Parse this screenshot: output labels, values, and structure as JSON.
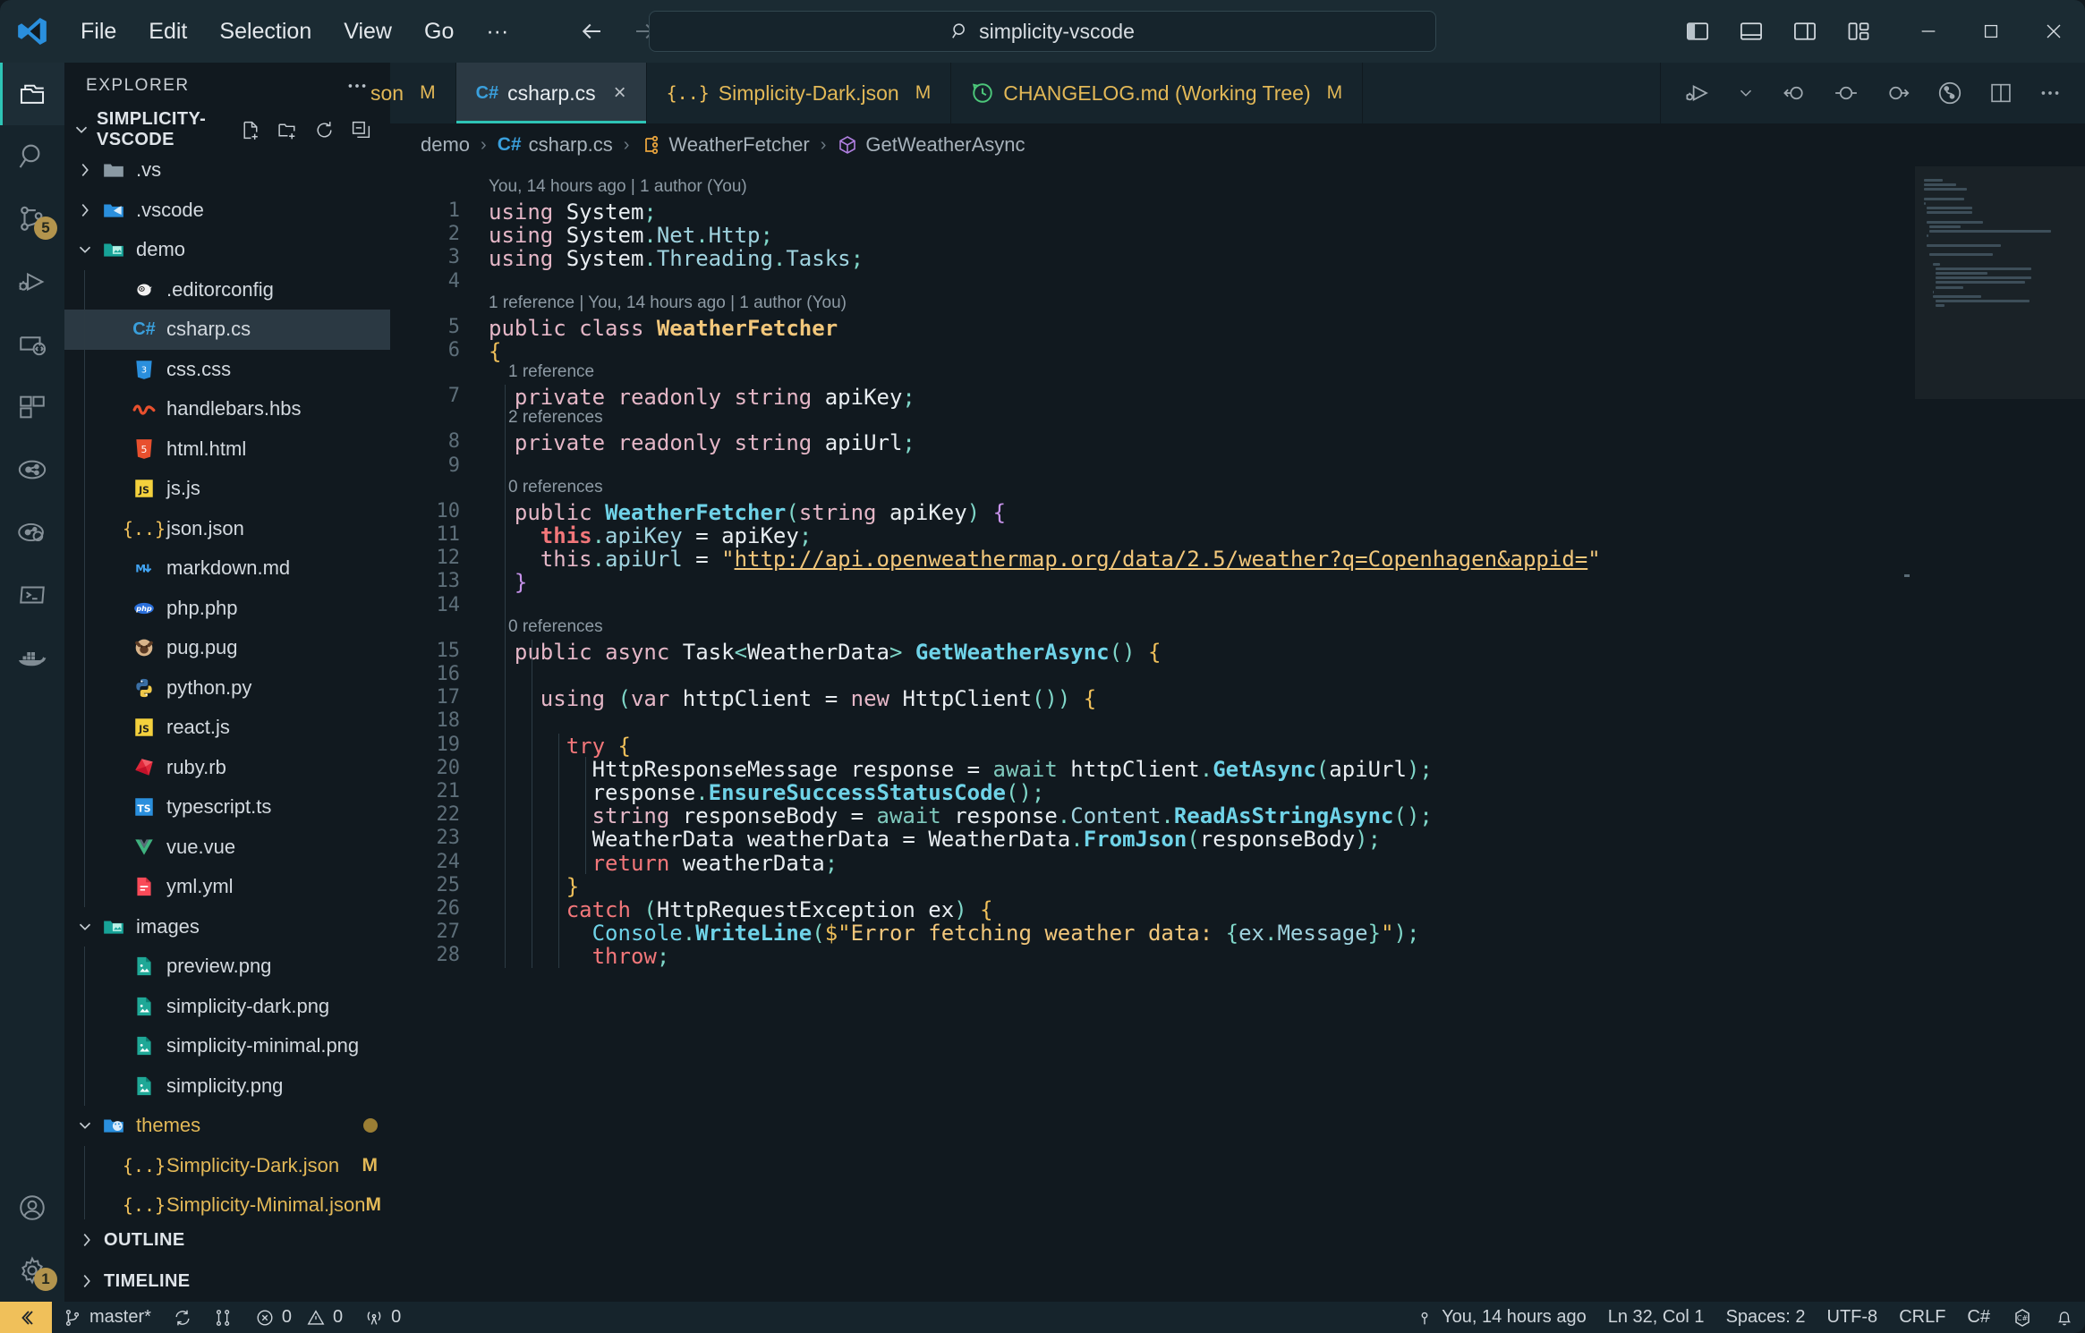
{
  "titlebar": {
    "menu": [
      "File",
      "Edit",
      "Selection",
      "View",
      "Go",
      "···"
    ],
    "command_center_text": "simplicity-vscode",
    "back_icon": "arrow-left-icon",
    "forward_icon": "arrow-right-icon",
    "search_icon": "search-icon",
    "layout_icons": [
      "toggle-primary-sidebar-icon",
      "toggle-panel-icon",
      "toggle-secondary-sidebar-icon",
      "customize-layout-icon"
    ],
    "window_controls": [
      "minimize",
      "maximize",
      "close"
    ]
  },
  "activitybar": {
    "items": [
      {
        "name": "explorer",
        "icon": "files-icon",
        "active": true,
        "badge": ""
      },
      {
        "name": "search",
        "icon": "search-icon",
        "active": false,
        "badge": ""
      },
      {
        "name": "source-control",
        "icon": "source-control-icon",
        "active": false,
        "badge": "5"
      },
      {
        "name": "run-and-debug",
        "icon": "debug-icon",
        "active": false,
        "badge": ""
      },
      {
        "name": "remote-explorer",
        "icon": "remote-explorer-icon",
        "active": false,
        "badge": ""
      },
      {
        "name": "extensions",
        "icon": "extensions-icon",
        "active": false,
        "badge": ""
      },
      {
        "name": "test-explorer",
        "icon": "beaker-icon",
        "active": false,
        "badge": ""
      },
      {
        "name": "live-share",
        "icon": "live-share-icon",
        "active": false,
        "badge": ""
      },
      {
        "name": "terminal",
        "icon": "terminal-icon",
        "active": false,
        "badge": ""
      },
      {
        "name": "docker",
        "icon": "docker-icon",
        "active": false,
        "badge": ""
      }
    ],
    "bottom_items": [
      {
        "name": "accounts",
        "icon": "account-icon",
        "badge": ""
      },
      {
        "name": "manage-settings",
        "icon": "gear-icon",
        "badge": "1"
      }
    ]
  },
  "sidebar": {
    "title": "EXPLORER",
    "more_actions_icon": "ellipsis-icon",
    "folder_section": {
      "label": "SIMPLICITY-VSCODE",
      "expanded": true,
      "actions": [
        "new-file-icon",
        "new-folder-icon",
        "refresh-icon",
        "collapse-all-icon"
      ]
    },
    "tree": [
      {
        "label": ".vs",
        "type": "folder",
        "depth": 0,
        "expanded": false,
        "icon": "folder-grey-icon",
        "git": ""
      },
      {
        "label": ".vscode",
        "type": "folder",
        "depth": 0,
        "expanded": false,
        "icon": "folder-vscode-icon",
        "git": ""
      },
      {
        "label": "demo",
        "type": "folder",
        "depth": 0,
        "expanded": true,
        "icon": "folder-demo-icon",
        "git": ""
      },
      {
        "label": ".editorconfig",
        "type": "file",
        "depth": 1,
        "icon": "editorconfig-icon",
        "git": ""
      },
      {
        "label": "csharp.cs",
        "type": "file",
        "depth": 1,
        "icon": "csharp-icon",
        "git": "",
        "selected": true
      },
      {
        "label": "css.css",
        "type": "file",
        "depth": 1,
        "icon": "css-icon",
        "git": ""
      },
      {
        "label": "handlebars.hbs",
        "type": "file",
        "depth": 1,
        "icon": "handlebars-icon",
        "git": ""
      },
      {
        "label": "html.html",
        "type": "file",
        "depth": 1,
        "icon": "html-icon",
        "git": ""
      },
      {
        "label": "js.js",
        "type": "file",
        "depth": 1,
        "icon": "javascript-icon",
        "git": ""
      },
      {
        "label": "json.json",
        "type": "file",
        "depth": 1,
        "icon": "json-icon",
        "git": ""
      },
      {
        "label": "markdown.md",
        "type": "file",
        "depth": 1,
        "icon": "markdown-icon",
        "git": ""
      },
      {
        "label": "php.php",
        "type": "file",
        "depth": 1,
        "icon": "php-icon",
        "git": ""
      },
      {
        "label": "pug.pug",
        "type": "file",
        "depth": 1,
        "icon": "pug-icon",
        "git": ""
      },
      {
        "label": "python.py",
        "type": "file",
        "depth": 1,
        "icon": "python-icon",
        "git": ""
      },
      {
        "label": "react.js",
        "type": "file",
        "depth": 1,
        "icon": "javascript-icon",
        "git": ""
      },
      {
        "label": "ruby.rb",
        "type": "file",
        "depth": 1,
        "icon": "ruby-icon",
        "git": ""
      },
      {
        "label": "typescript.ts",
        "type": "file",
        "depth": 1,
        "icon": "typescript-icon",
        "git": ""
      },
      {
        "label": "vue.vue",
        "type": "file",
        "depth": 1,
        "icon": "vue-icon",
        "git": ""
      },
      {
        "label": "yml.yml",
        "type": "file",
        "depth": 1,
        "icon": "yaml-icon",
        "git": ""
      },
      {
        "label": "images",
        "type": "folder",
        "depth": 0,
        "expanded": true,
        "icon": "folder-images-icon",
        "git": ""
      },
      {
        "label": "preview.png",
        "type": "file",
        "depth": 1,
        "icon": "image-icon",
        "git": ""
      },
      {
        "label": "simplicity-dark.png",
        "type": "file",
        "depth": 1,
        "icon": "image-icon",
        "git": ""
      },
      {
        "label": "simplicity-minimal.png",
        "type": "file",
        "depth": 1,
        "icon": "image-icon",
        "git": ""
      },
      {
        "label": "simplicity.png",
        "type": "file",
        "depth": 1,
        "icon": "image-icon",
        "git": ""
      },
      {
        "label": "themes",
        "type": "folder",
        "depth": 0,
        "expanded": true,
        "icon": "folder-themes-icon",
        "git": "dot",
        "modified": true
      },
      {
        "label": "Simplicity-Dark.json",
        "type": "file",
        "depth": 1,
        "icon": "json-icon",
        "git": "M",
        "modified": true
      },
      {
        "label": "Simplicity-Minimal.json",
        "type": "file",
        "depth": 1,
        "icon": "json-icon",
        "git": "M",
        "modified": true
      }
    ],
    "bottom_sections": [
      {
        "label": "OUTLINE",
        "expanded": false
      },
      {
        "label": "TIMELINE",
        "expanded": false
      }
    ]
  },
  "tabs": [
    {
      "label": "son",
      "git": "M",
      "active": false,
      "icon": "json-icon",
      "truncated": true,
      "close": ""
    },
    {
      "label": "csharp.cs",
      "git": "",
      "active": true,
      "icon": "csharp-icon",
      "close": "×"
    },
    {
      "label": "Simplicity-Dark.json",
      "git": "M",
      "active": false,
      "icon": "json-icon",
      "close": ""
    },
    {
      "label": "CHANGELOG.md (Working Tree)",
      "git": "M",
      "active": false,
      "icon": "git-compare-icon",
      "close": ""
    }
  ],
  "tabbar_actions": [
    "run-or-debug-icon",
    "chevron-down-icon",
    "step-back-icon",
    "step-over-icon",
    "step-into-icon",
    "source-control-graph-icon",
    "split-editor-icon",
    "more-actions-icon"
  ],
  "breadcrumbs": [
    {
      "label": "demo",
      "icon": ""
    },
    {
      "label": "csharp.cs",
      "icon": "csharp-icon"
    },
    {
      "label": "WeatherFetcher",
      "icon": "class-icon"
    },
    {
      "label": "GetWeatherAsync",
      "icon": "method-icon"
    }
  ],
  "editor": {
    "codelens": [
      {
        "line": 0,
        "text": "You, 14 hours ago | 1 author (You)"
      },
      {
        "line": 4,
        "text": "1 reference | You, 14 hours ago | 1 author (You)"
      },
      {
        "line": 6,
        "text": "1 reference"
      },
      {
        "line": 7,
        "text": "2 references"
      },
      {
        "line": 9,
        "text": "0 references"
      },
      {
        "line": 14,
        "text": "0 references"
      }
    ],
    "lines": [
      {
        "n": 1,
        "text": "using System;"
      },
      {
        "n": 2,
        "text": "using System.Net.Http;"
      },
      {
        "n": 3,
        "text": "using System.Threading.Tasks;"
      },
      {
        "n": 4,
        "text": ""
      },
      {
        "n": 5,
        "text": "public class WeatherFetcher"
      },
      {
        "n": 6,
        "text": "{"
      },
      {
        "n": 7,
        "text": "  private readonly string apiKey;"
      },
      {
        "n": 8,
        "text": "  private readonly string apiUrl;"
      },
      {
        "n": 9,
        "text": ""
      },
      {
        "n": 10,
        "text": "  public WeatherFetcher(string apiKey) {"
      },
      {
        "n": 11,
        "text": "    this.apiKey = apiKey;"
      },
      {
        "n": 12,
        "text": "    this.apiUrl = \"http://api.openweathermap.org/data/2.5/weather?q=Copenhagen&appid=\""
      },
      {
        "n": 13,
        "text": "  }"
      },
      {
        "n": 14,
        "text": ""
      },
      {
        "n": 15,
        "text": "  public async Task<WeatherData> GetWeatherAsync() {"
      },
      {
        "n": 16,
        "text": ""
      },
      {
        "n": 17,
        "text": "    using (var httpClient = new HttpClient()) {"
      },
      {
        "n": 18,
        "text": ""
      },
      {
        "n": 19,
        "text": "      try {"
      },
      {
        "n": 20,
        "text": "        HttpResponseMessage response = await httpClient.GetAsync(apiUrl);"
      },
      {
        "n": 21,
        "text": "        response.EnsureSuccessStatusCode();"
      },
      {
        "n": 22,
        "text": "        string responseBody = await response.Content.ReadAsStringAsync();"
      },
      {
        "n": 23,
        "text": "        WeatherData weatherData = WeatherData.FromJson(responseBody);"
      },
      {
        "n": 24,
        "text": "        return weatherData;"
      },
      {
        "n": 25,
        "text": "      }"
      },
      {
        "n": 26,
        "text": "      catch (HttpRequestException ex) {"
      },
      {
        "n": 27,
        "text": "        Console.WriteLine($\"Error fetching weather data: {ex.Message}\");"
      },
      {
        "n": 28,
        "text": "        throw;"
      }
    ]
  },
  "statusbar": {
    "remote_icon": "remote-window-icon",
    "left": [
      {
        "name": "branch",
        "icon": "git-branch-icon",
        "label": "master*"
      },
      {
        "name": "sync",
        "icon": "sync-icon",
        "label": ""
      },
      {
        "name": "branch-compare",
        "icon": "git-compare-icon",
        "label": ""
      },
      {
        "name": "problems",
        "icon": "error-icon",
        "label": "0",
        "icon2": "warning-icon",
        "label2": "0"
      },
      {
        "name": "ports",
        "icon": "radio-tower-icon",
        "label": "0"
      }
    ],
    "right": [
      {
        "name": "git-blame",
        "icon": "git-commit-icon",
        "label": "You, 14 hours ago"
      },
      {
        "name": "cursor-position",
        "label": "Ln 32, Col 1"
      },
      {
        "name": "indentation",
        "label": "Spaces: 2"
      },
      {
        "name": "encoding",
        "label": "UTF-8"
      },
      {
        "name": "eol",
        "label": "CRLF"
      },
      {
        "name": "language-mode",
        "label": "C#"
      },
      {
        "name": "csharp-status",
        "icon": "csharp-badge-icon",
        "label": ""
      },
      {
        "name": "notifications",
        "icon": "bell-icon",
        "label": ""
      }
    ]
  },
  "colors": {
    "titlebar_bg": "#1b2b33",
    "activitybar_bg": "#16242c",
    "sidebar_bg": "#11191f",
    "editor_bg": "#11191f",
    "tab_active_bg": "#2b3943",
    "accent": "#2ec4b6",
    "badge": "#f0c05a",
    "modified": "#e2b857",
    "string": "#f2c77b",
    "keyword": "#e5b7c7",
    "control": "#f2777a",
    "method": "#6fd3e8",
    "type": "#f2c77b"
  }
}
